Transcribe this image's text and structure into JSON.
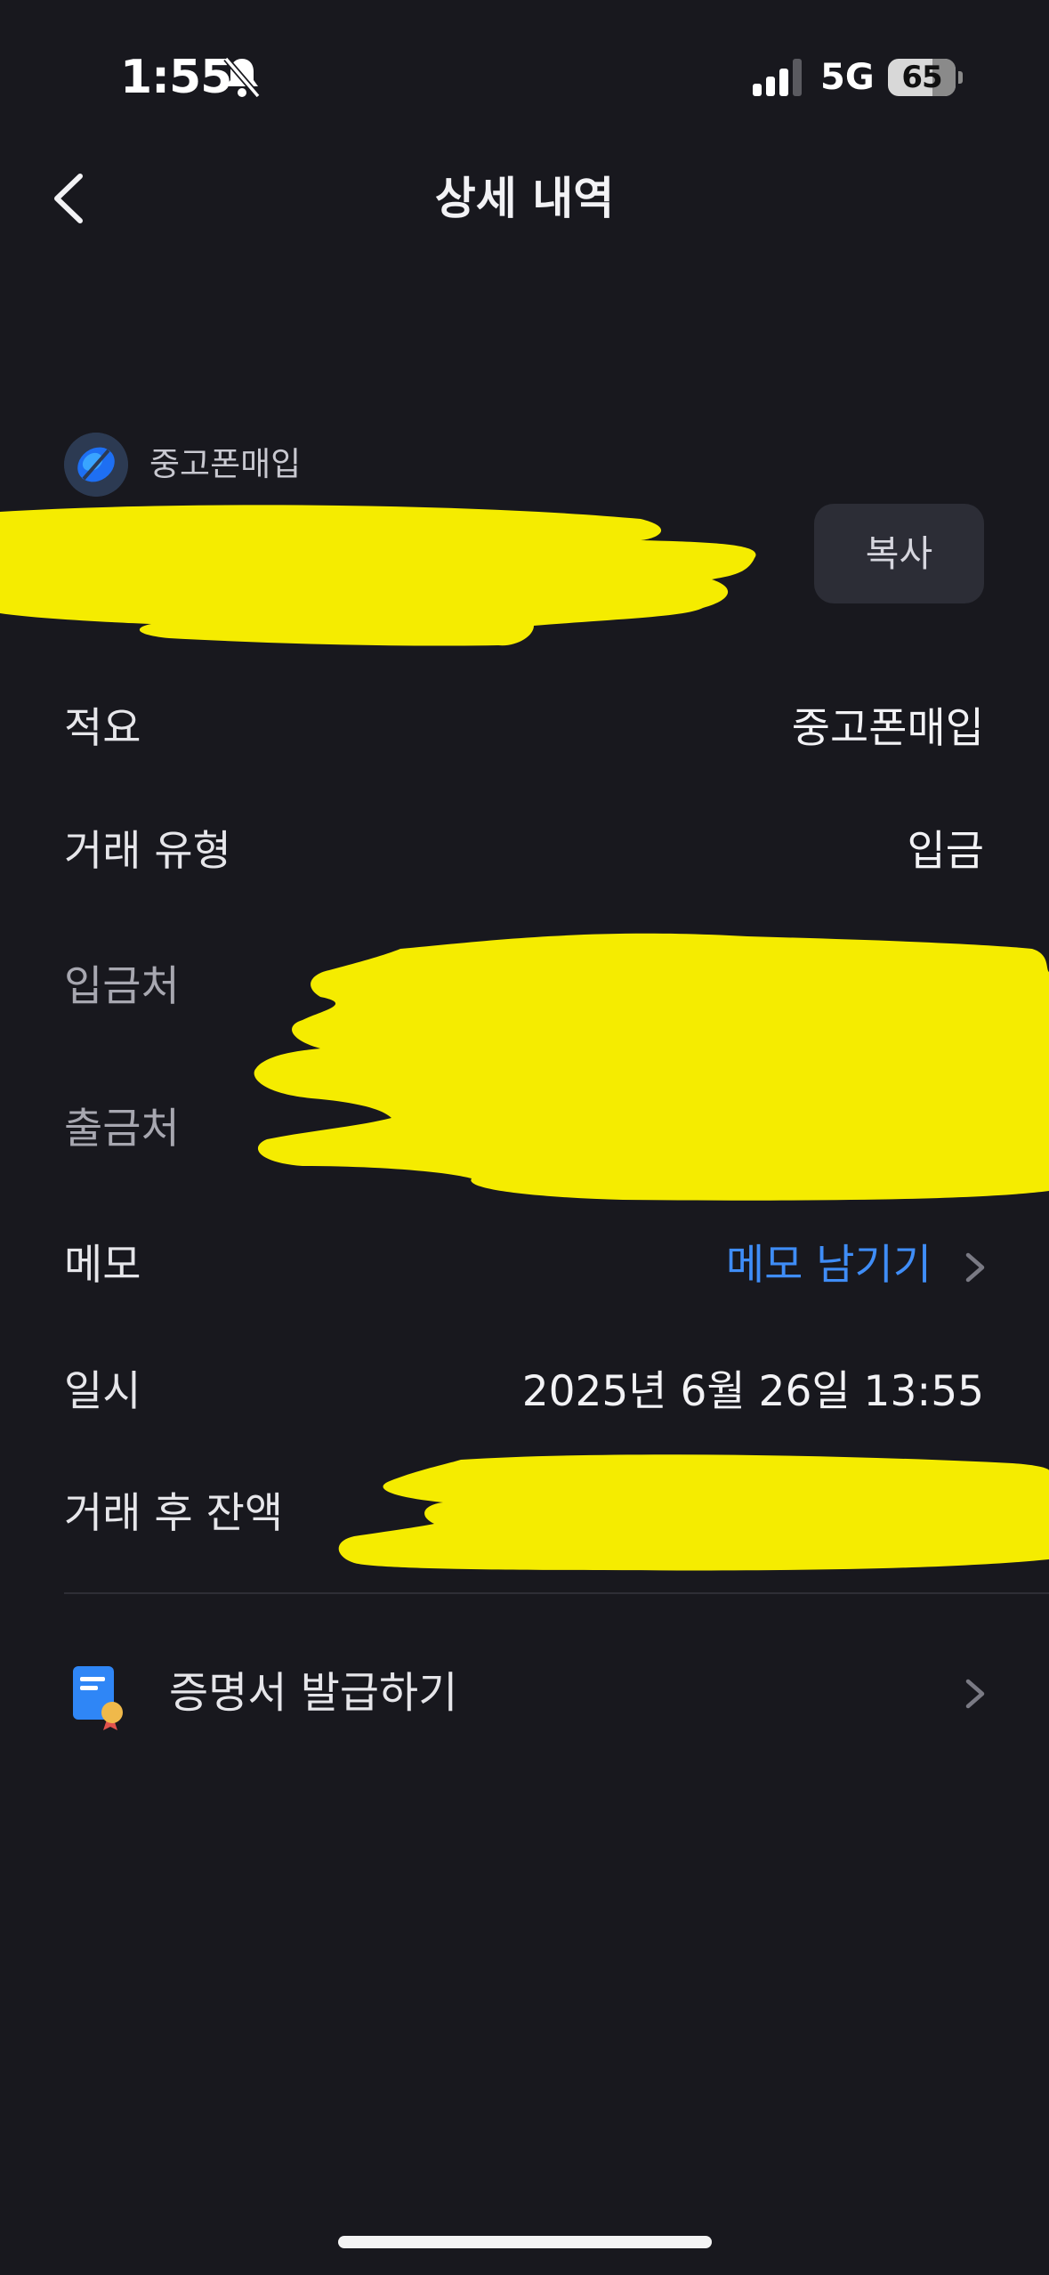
{
  "status_bar": {
    "time": "1:55",
    "network": "5G",
    "battery": "65"
  },
  "header": {
    "title": "상세 내역"
  },
  "merchant": {
    "name": "중고폰매입",
    "copy_label": "복사"
  },
  "details": {
    "summary_label": "적요",
    "summary_value": "중고폰매입",
    "type_label": "거래 유형",
    "type_value": "입금",
    "depositor_label": "입금처",
    "withdrawal_label": "출금처",
    "memo_label": "메모",
    "memo_action": "메모 남기기",
    "datetime_label": "일시",
    "datetime_value": "2025년 6월 26일 13:55",
    "balance_label": "거래 후 잔액"
  },
  "certificate": {
    "label": "증명서 발급하기"
  },
  "colors": {
    "background": "#18181e",
    "accent_link": "#3f8df7",
    "redaction": "#f5ec00"
  },
  "icons": {
    "back": "chevron-left-icon",
    "memo": "chevron-right-icon",
    "certificate": "document-certificate-icon"
  }
}
